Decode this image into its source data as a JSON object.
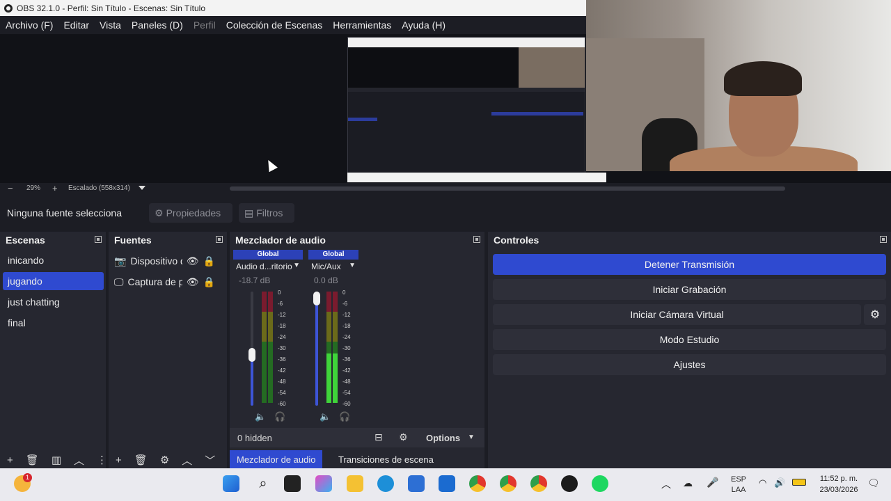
{
  "window": {
    "title": "OBS 32.1.0 - Perfil: Sin Título - Escenas: Sin Título"
  },
  "menu": {
    "items": [
      {
        "label": "Archivo (F)",
        "enabled": true
      },
      {
        "label": "Editar",
        "enabled": true
      },
      {
        "label": "Vista",
        "enabled": true
      },
      {
        "label": "Paneles (D)",
        "enabled": true
      },
      {
        "label": "Perfil",
        "enabled": false
      },
      {
        "label": "Colección de Escenas",
        "enabled": true
      },
      {
        "label": "Herramientas",
        "enabled": true
      },
      {
        "label": "Ayuda (H)",
        "enabled": true
      }
    ]
  },
  "preview": {
    "zoom_minus": "−",
    "zoom_level": "29%",
    "zoom_plus": "+",
    "scale_label": "Escalado (558x314)"
  },
  "source_toolbar": {
    "status": "Ninguna fuente selecciona",
    "properties_label": "Propiedades",
    "filters_label": "Filtros"
  },
  "scenes": {
    "title": "Escenas",
    "items": [
      {
        "label": "inicando",
        "selected": false
      },
      {
        "label": "jugando",
        "selected": true
      },
      {
        "label": "just chatting",
        "selected": false
      },
      {
        "label": "final",
        "selected": false
      }
    ]
  },
  "sources": {
    "title": "Fuentes",
    "items": [
      {
        "label": "Dispositivo d",
        "icon": "camera-icon"
      },
      {
        "label": "Captura de p",
        "icon": "monitor-icon"
      }
    ]
  },
  "mixer": {
    "title": "Mezclador de audio",
    "channels": [
      {
        "header": "Global",
        "name": "Audio d...ritorio",
        "db": "-18.7 dB",
        "level": 0.44
      },
      {
        "header": "Global",
        "name": "Mic/Aux",
        "db": "0.0 dB",
        "level": 1.0
      }
    ],
    "ticks": [
      "0",
      "-6",
      "-12",
      "-18",
      "-24",
      "-30",
      "-36",
      "-42",
      "-48",
      "-54",
      "-60"
    ],
    "hidden_label": "0 hidden",
    "options_label": "Options",
    "tabs": [
      {
        "label": "Mezclador de audio",
        "active": true
      },
      {
        "label": "Transiciones de escena",
        "active": false
      }
    ]
  },
  "controls": {
    "title": "Controles",
    "buttons": [
      {
        "label": "Detener Transmisión",
        "active": true
      },
      {
        "label": "Iniciar Grabación",
        "active": false
      },
      {
        "label": "Iniciar Cámara Virtual",
        "active": false
      },
      {
        "label": "Modo Estudio",
        "active": false
      },
      {
        "label": "Ajustes",
        "active": false
      }
    ]
  },
  "taskbar": {
    "notification_badge": "1",
    "lang_primary": "ESP",
    "lang_secondary": "LAA",
    "time": "11:52 p. m.",
    "date": "23/03/2026",
    "colors": {
      "accent": "#2f4ad0",
      "background": "#eaeaef"
    }
  }
}
